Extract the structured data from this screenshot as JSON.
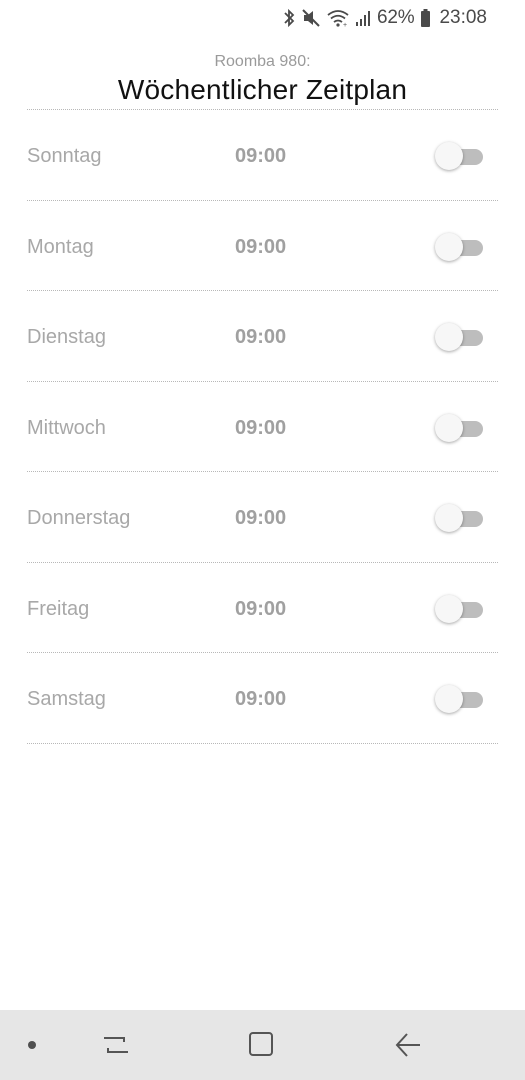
{
  "status_bar": {
    "battery_percent": "62%",
    "time": "23:08",
    "icons": [
      "bluetooth-icon",
      "mute-icon",
      "wifi-icon",
      "signal-icon",
      "battery-icon"
    ]
  },
  "header": {
    "subtitle": "Roomba 980:",
    "title": "Wöchentlicher Zeitplan"
  },
  "schedule": [
    {
      "day": "Sonntag",
      "time": "09:00",
      "enabled": false
    },
    {
      "day": "Montag",
      "time": "09:00",
      "enabled": false
    },
    {
      "day": "Dienstag",
      "time": "09:00",
      "enabled": false
    },
    {
      "day": "Mittwoch",
      "time": "09:00",
      "enabled": false
    },
    {
      "day": "Donnerstag",
      "time": "09:00",
      "enabled": false
    },
    {
      "day": "Freitag",
      "time": "09:00",
      "enabled": false
    },
    {
      "day": "Samstag",
      "time": "09:00",
      "enabled": false
    }
  ],
  "nav_bar": {
    "buttons": [
      "recent-apps-icon",
      "home-icon",
      "back-icon"
    ]
  },
  "colors": {
    "title": "#111111",
    "muted_text": "#a8a8a8",
    "toggle_track_off": "#bdbdbd",
    "toggle_thumb": "#f7f7f7",
    "nav_background": "#e6e6e6"
  }
}
